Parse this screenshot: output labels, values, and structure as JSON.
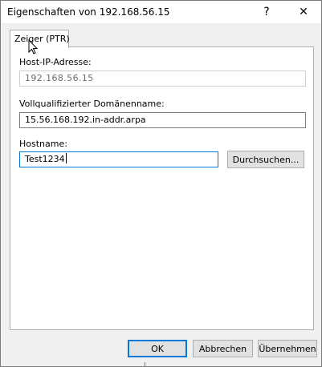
{
  "window": {
    "title": "Eigenschaften von 192.168.56.15",
    "help_glyph": "?",
    "close_glyph": "✕"
  },
  "tabs": [
    {
      "label": "Zeiger (PTR)",
      "selected": true
    }
  ],
  "form": {
    "host_ip_label": "Host-IP-Adresse:",
    "host_ip_value": "192.168.56.15",
    "fqdn_label": "Vollqualifizierter Domänenname:",
    "fqdn_value": "15.56.168.192.in-addr.arpa",
    "hostname_label": "Hostname:",
    "hostname_value": "Test1234",
    "browse_label": "Durchsuchen..."
  },
  "footer": {
    "ok_label": "OK",
    "cancel_label": "Abbrechen",
    "apply_label": "Übernehmen"
  },
  "colors": {
    "focus_accent": "#0078d7",
    "dialog_bg": "#f0f0f0",
    "button_bg": "#e1e1e1"
  }
}
